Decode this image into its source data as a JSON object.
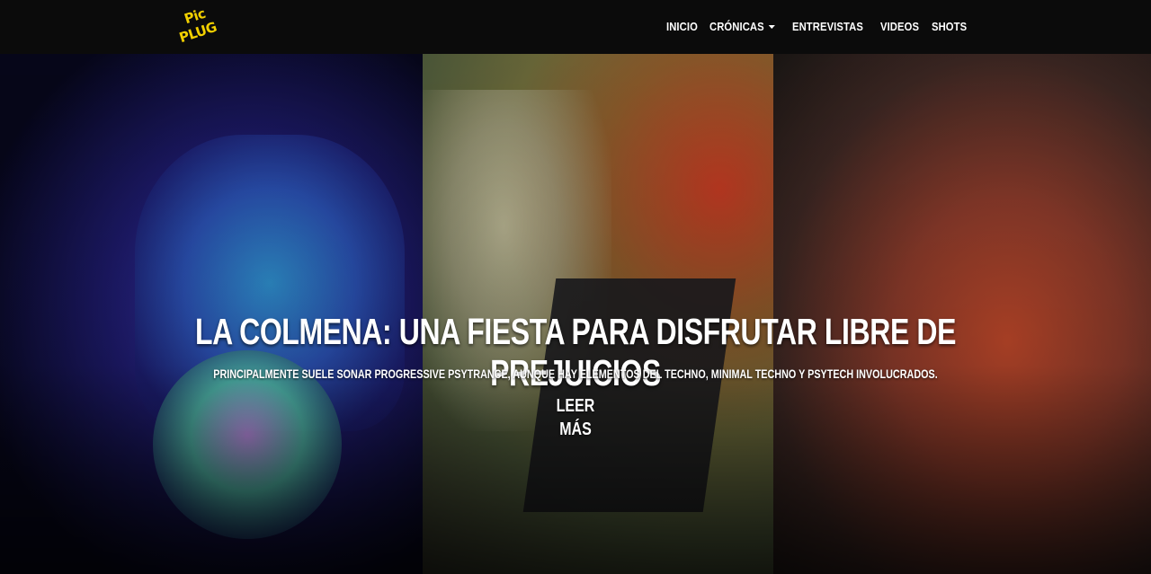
{
  "brand": {
    "logo_line1": "Pic",
    "logo_line2": "PLUG",
    "logo_color": "#f2d000"
  },
  "nav": {
    "items": [
      {
        "label": "INICIO"
      },
      {
        "label": "CRÓNICAS",
        "has_dropdown": true
      },
      {
        "label": "ENTREVISTAS"
      },
      {
        "label": "VIDEOS"
      },
      {
        "label": "SHOTS"
      }
    ]
  },
  "hero": {
    "title": "LA COLMENA: UNA FIESTA PARA DISFRUTAR LIBRE DE PREJUICIOS",
    "subtitle": "PRINCIPALMENTE SUELE SONAR PROGRESSIVE PSYTRANCE, AUNQUE HAY ELEMENTOS DEL TECHNO, MINIMAL TECHNO Y PSYTECH INVOLUCRADOS.",
    "cta": "LEER MÁS"
  },
  "colors": {
    "navbar_bg": "#0b0b0b",
    "text": "#ffffff"
  }
}
